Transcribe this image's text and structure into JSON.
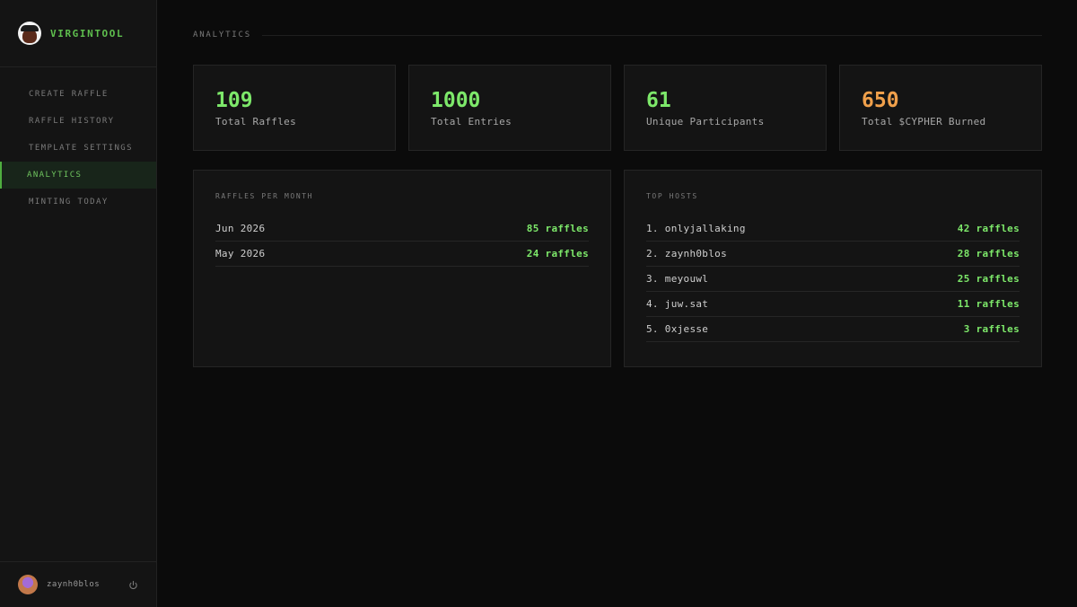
{
  "brand": {
    "name": "VIRGINTOOL"
  },
  "nav": {
    "items": [
      {
        "label": "CREATE RAFFLE"
      },
      {
        "label": "RAFFLE HISTORY"
      },
      {
        "label": "TEMPLATE SETTINGS"
      },
      {
        "label": "ANALYTICS"
      },
      {
        "label": "MINTING TODAY"
      }
    ],
    "active": "ANALYTICS"
  },
  "user": {
    "name": "zaynh0blos"
  },
  "section": {
    "title": "ANALYTICS"
  },
  "stats": [
    {
      "value": "109",
      "label": "Total Raffles"
    },
    {
      "value": "1000",
      "label": "Total Entries"
    },
    {
      "value": "61",
      "label": "Unique Participants"
    },
    {
      "value": "650",
      "label": "Total $CYPHER Burned"
    }
  ],
  "raffles_per_month": {
    "title": "RAFFLES PER MONTH",
    "rows": [
      {
        "label": "Jun 2026",
        "value": "85 raffles"
      },
      {
        "label": "May 2026",
        "value": "24 raffles"
      }
    ]
  },
  "top_hosts": {
    "title": "TOP HOSTS",
    "rows": [
      {
        "label": "1. onlyjallaking",
        "value": "42 raffles"
      },
      {
        "label": "2. zaynh0blos",
        "value": "28 raffles"
      },
      {
        "label": "3. meyouwl",
        "value": "25 raffles"
      },
      {
        "label": "4. juw.sat",
        "value": "11 raffles"
      },
      {
        "label": "5. 0xjesse",
        "value": "3 raffles"
      }
    ]
  },
  "colors": {
    "accent_green": "#7de86a",
    "accent_orange": "#f0a04b",
    "brand_green": "#5fbf4e"
  }
}
